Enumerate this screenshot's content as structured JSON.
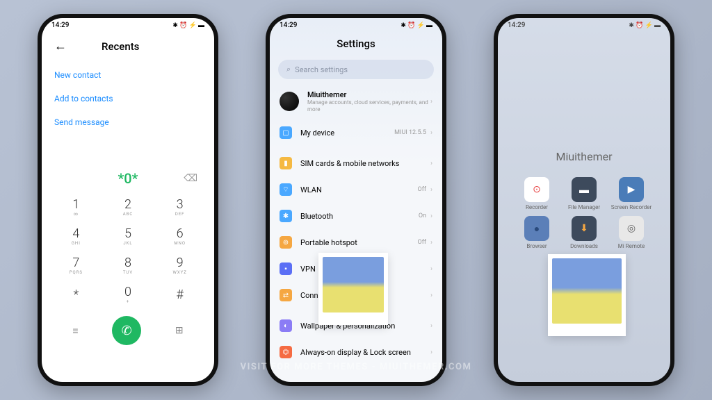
{
  "status": {
    "time": "14:29",
    "icons": "✱ ⏰ ⚡ ▬"
  },
  "phone1": {
    "title": "Recents",
    "links": [
      "New contact",
      "Add to contacts",
      "Send message"
    ],
    "display": "*0*",
    "keys": [
      {
        "n": "1",
        "s": "∞"
      },
      {
        "n": "2",
        "s": "ABC"
      },
      {
        "n": "3",
        "s": "DEF"
      },
      {
        "n": "4",
        "s": "GHI"
      },
      {
        "n": "5",
        "s": "JKL"
      },
      {
        "n": "6",
        "s": "MNO"
      },
      {
        "n": "7",
        "s": "PQRS"
      },
      {
        "n": "8",
        "s": "TUV"
      },
      {
        "n": "9",
        "s": "WXYZ"
      },
      {
        "n": "*",
        "s": ""
      },
      {
        "n": "0",
        "s": "+"
      },
      {
        "n": "#",
        "s": ""
      }
    ]
  },
  "phone2": {
    "title": "Settings",
    "search": "Search settings",
    "account": {
      "name": "Miuithemer",
      "sub": "Manage accounts, cloud services, payments, and more"
    },
    "items": [
      {
        "label": "My device",
        "value": "MIUI 12.5.5",
        "color": "#4aa8ff",
        "glyph": "▢"
      },
      {
        "label": "SIM cards & mobile networks",
        "value": "",
        "color": "#f5b942",
        "glyph": "▮"
      },
      {
        "label": "WLAN",
        "value": "Off",
        "color": "#4aa8ff",
        "glyph": "⌔"
      },
      {
        "label": "Bluetooth",
        "value": "On",
        "color": "#4aa8ff",
        "glyph": "✱"
      },
      {
        "label": "Portable hotspot",
        "value": "Off",
        "color": "#f5a742",
        "glyph": "⊚"
      },
      {
        "label": "VPN",
        "value": "",
        "color": "#5b6ff5",
        "glyph": "▪"
      },
      {
        "label": "Connection & sharing",
        "value": "",
        "color": "#f5a742",
        "glyph": "⇄"
      },
      {
        "label": "Wallpaper & personalization",
        "value": "",
        "color": "#8b7cf5",
        "glyph": "◐"
      },
      {
        "label": "Always-on display & Lock screen",
        "value": "",
        "color": "#f56b42",
        "glyph": "⏣"
      }
    ]
  },
  "phone3": {
    "folder_title": "Miuithemer",
    "apps": [
      {
        "label": "Recorder",
        "bg": "#fff",
        "glyph": "⊙",
        "color": "#e84545"
      },
      {
        "label": "File Manager",
        "bg": "#3d4a5c",
        "glyph": "▬",
        "color": "#fff"
      },
      {
        "label": "Screen Recorder",
        "bg": "#4a7cb8",
        "glyph": "▶",
        "color": "#fff"
      },
      {
        "label": "Browser",
        "bg": "#5b7fb8",
        "glyph": "●",
        "color": "#2a4a7c"
      },
      {
        "label": "Downloads",
        "bg": "#3d4a5c",
        "glyph": "⬇",
        "color": "#f5a742"
      },
      {
        "label": "Mi Remote",
        "bg": "#e8e8e8",
        "glyph": "◎",
        "color": "#666"
      }
    ]
  },
  "watermark": "Visit for more themes - miuithemer.com"
}
